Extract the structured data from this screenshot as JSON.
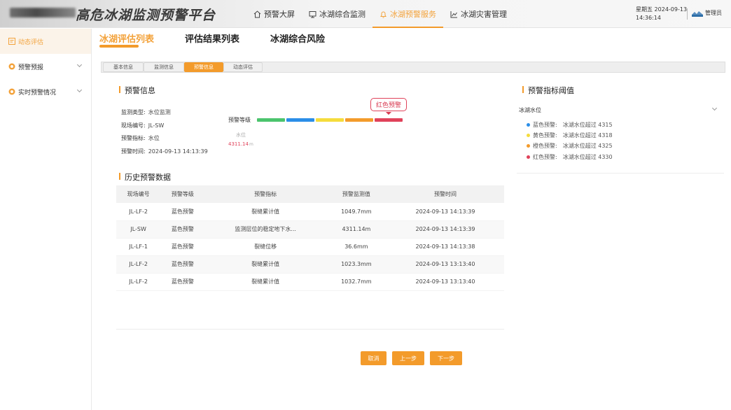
{
  "header": {
    "title": "高危冰湖监测预警平台",
    "nav": [
      {
        "label": "预警大屏",
        "icon": "home-icon"
      },
      {
        "label": "冰湖综合监测",
        "icon": "monitor-icon"
      },
      {
        "label": "冰湖预警服务",
        "icon": "bell-icon",
        "active": true
      },
      {
        "label": "冰湖灾害管理",
        "icon": "chart-icon"
      }
    ],
    "weekday": "星期五",
    "date": "2024-09-13",
    "time": "14:36:14",
    "user": "管理员"
  },
  "sidebar": {
    "items": [
      {
        "label": "动态评估",
        "icon": "assessment-icon",
        "active": true
      },
      {
        "label": "预警预报",
        "icon": "forecast-icon"
      },
      {
        "label": "实时预警情况",
        "icon": "realtime-alert-icon"
      }
    ]
  },
  "main": {
    "tabs": [
      "冰湖评估列表",
      "评估结果列表",
      "冰湖综合风险"
    ],
    "steps": [
      "基本信息",
      "监测信息",
      "预警信息",
      "动态评估"
    ],
    "warning_info": {
      "title": "预警信息",
      "fields": [
        {
          "key": "监测类型:",
          "value": "水位监测"
        },
        {
          "key": "现场编号:",
          "value": "JL-SW"
        },
        {
          "key": "预警指标:",
          "value": "水位"
        },
        {
          "key": "预警时间:",
          "value": "2024-09-13 14:13:39"
        }
      ],
      "level_label": "预警等级",
      "level_colors": [
        "#4bc46d",
        "#2b8ee8",
        "#f5dc3c",
        "#f39b2b",
        "#e0425a"
      ],
      "callout": "红色预警",
      "water_level_label": "水位",
      "water_level_value": "4311.14",
      "water_level_unit": "m"
    },
    "history": {
      "title": "历史预警数据",
      "columns": [
        "现场编号",
        "预警等级",
        "预警指标",
        "预警监测值",
        "预警时间"
      ],
      "rows": [
        [
          "JL-LF-2",
          "蓝色预警",
          "裂缝累计值",
          "1049.7mm",
          "2024-09-13 14:13:39"
        ],
        [
          "JL-SW",
          "蓝色预警",
          "监测层位的稳定地下水...",
          "4311.14m",
          "2024-09-13 14:13:39"
        ],
        [
          "JL-LF-1",
          "蓝色预警",
          "裂缝位移",
          "36.6mm",
          "2024-09-13 14:13:38"
        ],
        [
          "JL-LF-2",
          "蓝色预警",
          "裂缝累计值",
          "1023.3mm",
          "2024-09-13 13:13:40"
        ],
        [
          "JL-LF-2",
          "蓝色预警",
          "裂缝累计值",
          "1032.7mm",
          "2024-09-13 13:13:40"
        ]
      ]
    },
    "buttons": {
      "cancel": "取消",
      "prev": "上一步",
      "next": "下一步"
    }
  },
  "thresholds": {
    "title": "预警指标阈值",
    "group": "冰湖水位",
    "items": [
      {
        "label": "蓝色预警:",
        "value": "冰湖水位超过 4315",
        "color": "#2b8ee8"
      },
      {
        "label": "黄色预警:",
        "value": "冰湖水位超过 4318",
        "color": "#f5dc3c"
      },
      {
        "label": "橙色预警:",
        "value": "冰湖水位超过 4325",
        "color": "#f39b2b"
      },
      {
        "label": "红色预警:",
        "value": "冰湖水位超过 4330",
        "color": "#e0425a"
      }
    ]
  }
}
